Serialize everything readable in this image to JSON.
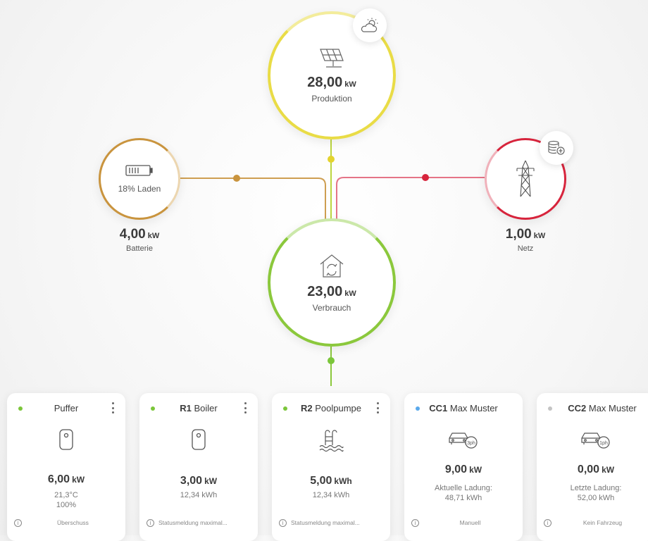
{
  "colors": {
    "solar": "#e9dc46",
    "consumption": "#8bc83c",
    "battery": "#c9943e",
    "grid": "#d7243c",
    "status_green": "#7bc63a",
    "status_blue": "#5aa9ec",
    "status_grey": "#c4c4c4"
  },
  "production": {
    "value": "28,00",
    "unit": "kW",
    "label": "Produktion",
    "icon": "solar-panel-icon",
    "badge_icon": "partly-cloudy-icon"
  },
  "consumption": {
    "value": "23,00",
    "unit": "kW",
    "label": "Verbrauch",
    "icon": "house-icon"
  },
  "battery": {
    "status": "18% Laden",
    "value": "4,00",
    "unit": "kW",
    "label": "Batterie",
    "icon": "battery-icon"
  },
  "grid": {
    "value": "1,00",
    "unit": "kW",
    "label": "Netz",
    "icon": "power-pylon-icon",
    "badge_icon": "coins-icon"
  },
  "devices": [
    {
      "name_bold": "",
      "name": "Puffer",
      "status_color": "#7bc63a",
      "icon": "buffer-tank-icon",
      "value": "6,00",
      "unit": "kW",
      "sub1": "21,3°C",
      "sub2": "100%",
      "footer": "Überschuss"
    },
    {
      "name_bold": "R1",
      "name": "Boiler",
      "status_color": "#7bc63a",
      "icon": "boiler-icon",
      "value": "3,00",
      "unit": "kW",
      "sub1": "12,34 kWh",
      "sub2": "",
      "footer": "Statusmeldung maximal..."
    },
    {
      "name_bold": "R2",
      "name": "Poolpumpe",
      "status_color": "#7bc63a",
      "icon": "pool-icon",
      "value": "5,00",
      "unit": "kWh",
      "sub1": "12,34 kWh",
      "sub2": "",
      "footer": "Statusmeldung maximal..."
    },
    {
      "name_bold": "CC1",
      "name": "Max Muster",
      "status_color": "#5aa9ec",
      "icon": "car-3ph-icon",
      "car_phase": "3ph",
      "value": "9,00",
      "unit": "kW",
      "sub1": "Aktuelle Ladung:",
      "sub2": "48,71 kWh",
      "footer": "Manuell"
    },
    {
      "name_bold": "CC2",
      "name": "Max Muster",
      "status_color": "#c4c4c4",
      "icon": "car-1ph-icon",
      "car_phase": "1ph",
      "value": "0,00",
      "unit": "kW",
      "sub1": "Letzte Ladung:",
      "sub2": "52,00 kWh",
      "footer": "Kein Fahrzeug"
    }
  ]
}
